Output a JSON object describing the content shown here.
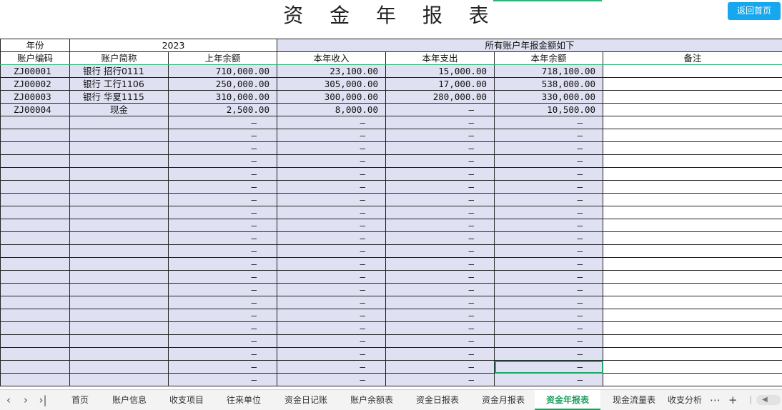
{
  "title": "资 金 年 报 表",
  "home_button": "返回首页",
  "header": {
    "year_label": "年份",
    "year_value": "2023",
    "summary": "所有账户年报金额如下"
  },
  "columns": [
    "账户编码",
    "账户简称",
    "上年余额",
    "本年收入",
    "本年支出",
    "本年余额",
    "备注"
  ],
  "rows": [
    {
      "code": "ZJ00001",
      "name": "银行 招行0111",
      "prev": "710,000.00",
      "income": "23,100.00",
      "expense": "15,000.00",
      "balance": "718,100.00",
      "note": ""
    },
    {
      "code": "ZJ00002",
      "name": "银行 工行1106",
      "prev": "250,000.00",
      "income": "305,000.00",
      "expense": "17,000.00",
      "balance": "538,000.00",
      "note": ""
    },
    {
      "code": "ZJ00003",
      "name": "银行 华夏1115",
      "prev": "310,000.00",
      "income": "300,000.00",
      "expense": "280,000.00",
      "balance": "330,000.00",
      "note": ""
    },
    {
      "code": "ZJ00004",
      "name": "现金",
      "prev": "2,500.00",
      "income": "8,000.00",
      "expense": "–",
      "balance": "10,500.00",
      "note": ""
    }
  ],
  "empty_value": "–",
  "tabs": [
    "首页",
    "账户信息",
    "收支项目",
    "往来单位",
    "资金日记账",
    "账户余额表",
    "资金日报表",
    "资金月报表",
    "资金年报表",
    "现金流量表",
    "收支分析"
  ],
  "active_tab": "资金年报表",
  "tabbar_controls": {
    "more": "⋯",
    "add": "+"
  },
  "colors": {
    "accent": "#1f9f5f",
    "button": "#17a7ef",
    "cell_fill": "#dfe1f2"
  }
}
